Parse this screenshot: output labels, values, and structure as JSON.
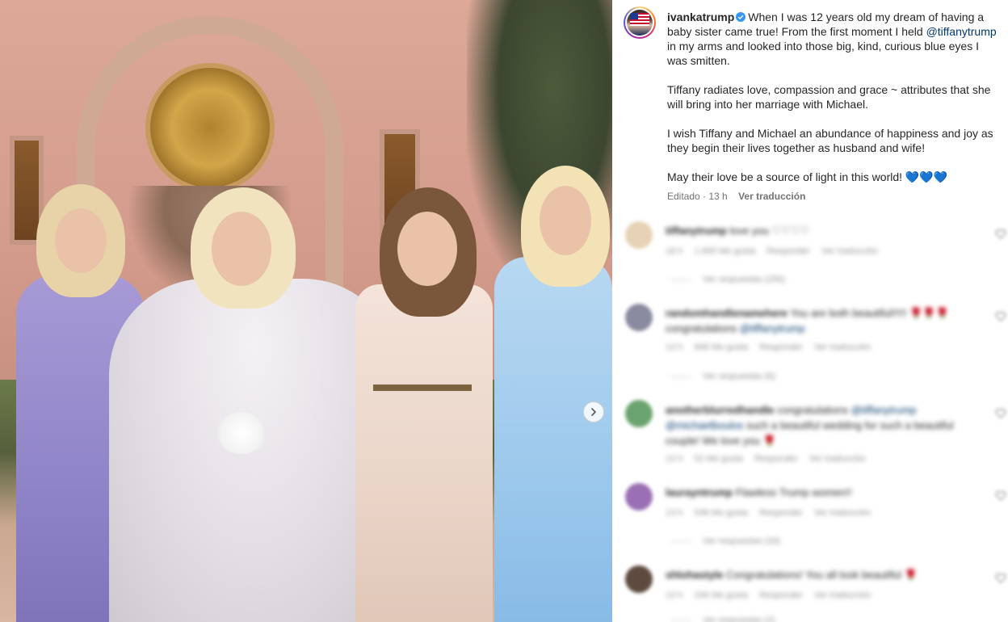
{
  "post": {
    "username": "ivankatrump",
    "caption_p1_a": "When I was 12 years old my dream of having a baby sister came true! From the first moment I held ",
    "caption_p1_mention": "@tiffanytrump",
    "caption_p1_b": " in my arms and looked into those big, kind, curious blue eyes I was smitten.",
    "caption_p2": "Tiffany radiates love, compassion and grace ~ attributes that she will bring into her marriage with Michael.",
    "caption_p3": "I wish Tiffany and Michael an abundance of happiness and joy as they begin their lives together as husband and wife!",
    "caption_p4": "May their love be a source of light in this world! 💙💙💙",
    "edited_label": "Editado · 13 h",
    "translate_label": "Ver traducción"
  },
  "icons": {
    "verified": "verified-badge-icon",
    "next": "chevron-right-icon",
    "like": "heart-icon"
  },
  "colors": {
    "verified_blue": "#3897f0",
    "mention_blue": "#00376b",
    "secondary_text": "#737373"
  },
  "comments": [
    {
      "user": "tiffanytrump",
      "text": "love you ♡♡♡♡",
      "meta": [
        "18 h",
        "1.665 Me gusta",
        "Responder",
        "Ver traducción"
      ],
      "replies": "Ver respuestas (256)"
    },
    {
      "user": "randomhandlenamehere",
      "text": "You are both beautiful!!!!! 🌹🌹🌹 congratulations",
      "mention": "@tiffanytrump",
      "meta": [
        "13 h",
        "848 Me gusta",
        "Responder",
        "Ver traducción"
      ],
      "replies": "Ver respuestas (6)"
    },
    {
      "user": "anotherblurredhandle",
      "text": "congratulations",
      "mention": "@tiffanytrump",
      "mention2": "@michaelboulos",
      "text2": "such a beautiful wedding for such a beautiful couple! We love you 🌹",
      "meta": [
        "13 h",
        "52 Me gusta",
        "Responder",
        "Ver traducción"
      ],
      "replies": ""
    },
    {
      "user": "laurayntrump",
      "text": "Flawless Trump women!!",
      "meta": [
        "13 h",
        "548 Me gusta",
        "Responder",
        "Ver traducción"
      ],
      "replies": "Ver respuestas (33)"
    },
    {
      "user": "shlohastyle",
      "text": "Congratulations! You all look beautiful 🌹",
      "meta": [
        "13 h",
        "246 Me gusta",
        "Responder",
        "Ver traducción"
      ],
      "replies": "Ver respuestas (2)"
    }
  ]
}
